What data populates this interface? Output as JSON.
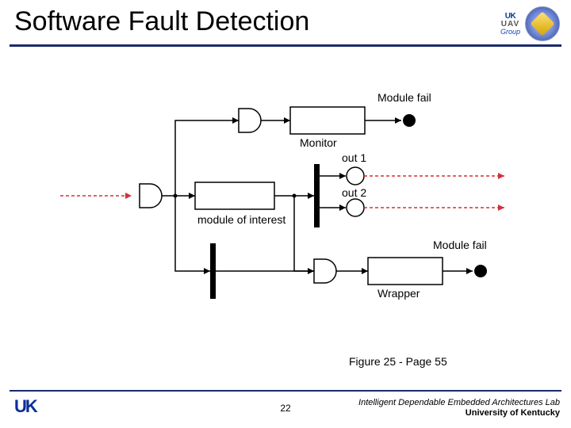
{
  "title": "Software Fault Detection",
  "logos": {
    "uav_top": "UK",
    "uav_mid": "UAV",
    "uav_bottom": "Group"
  },
  "diagram": {
    "module_of_interest": "module of interest",
    "monitor": "Monitor",
    "wrapper": "Wrapper",
    "module_fail_top": "Module fail",
    "module_fail_bottom": "Module fail",
    "out1": "out 1",
    "out2": "out 2"
  },
  "caption": "Figure 25 - Page 55",
  "footer": {
    "uk": "UK",
    "page": "22",
    "lab_line1": "Intelligent Dependable Embedded Architectures Lab",
    "lab_line2": "University of Kentucky"
  }
}
